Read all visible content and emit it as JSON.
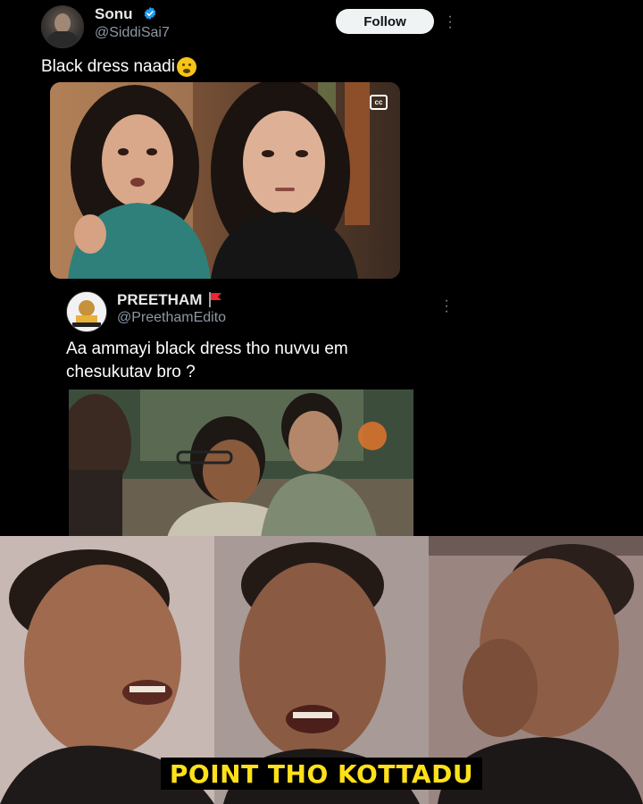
{
  "tweet": {
    "author_name": "Sonu",
    "author_handle": "@SiddiSai7",
    "follow_label": "Follow",
    "text": "Black dress naadi",
    "emoji_icon": "face-with-hand-over-mouth-icon",
    "media_badge": "cc"
  },
  "quoted": {
    "author_name": "PREETHAM",
    "author_handle": "@PreethamEdito",
    "text": "Aa ammayi black dress tho nuvvu em chesukutav bro ?"
  },
  "meme": {
    "caption": "POINT THO KOTTADU"
  },
  "colors": {
    "background": "#000000",
    "verified_badge": "#1d9bf0",
    "flag": "#f4212e",
    "caption_text": "#ffe11a"
  }
}
